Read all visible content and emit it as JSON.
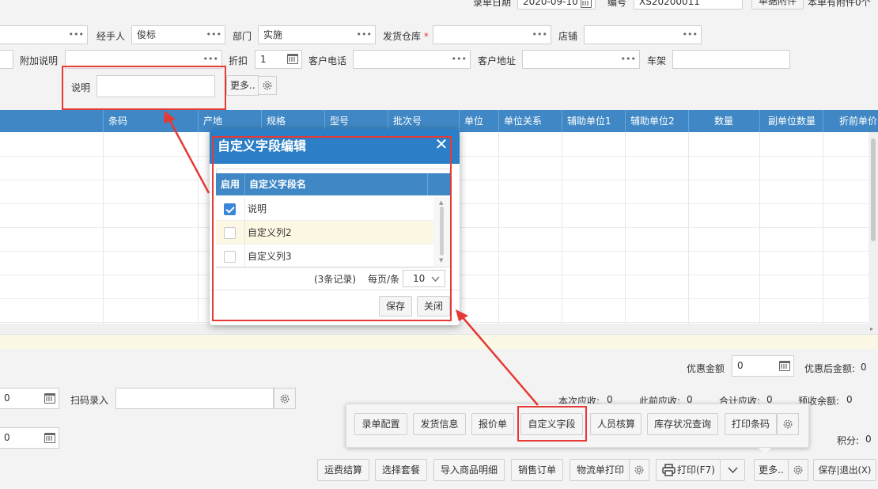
{
  "header_top": {
    "date_label": "录单日期",
    "date_value": "2020-09-10",
    "no_label": "编号",
    "no_value": "XS20200011",
    "attach_btn": "单据附件",
    "attach_info": "本单有附件0个"
  },
  "form": {
    "handler_label": "经手人",
    "handler_value": "俊标",
    "dept_label": "部门",
    "dept_value": "实施",
    "warehouse_label": "发货仓库",
    "warehouse_req": "*",
    "store_label": "店铺",
    "extra_label": "附加说明",
    "discount_label": "折扣",
    "discount_value": "1",
    "phone_label": "客户电话",
    "address_label": "客户地址",
    "frame_label": "车架",
    "note_label": "说明",
    "more_btn": "更多.."
  },
  "grid": {
    "columns": [
      "条码",
      "产地",
      "规格",
      "型号",
      "批次号",
      "单位",
      "单位关系",
      "辅助单位1",
      "辅助单位2",
      "数量",
      "副单位数量",
      "折前单价"
    ]
  },
  "dialog": {
    "title": "自定义字段编辑",
    "col_enabled": "启用",
    "col_name": "自定义字段名",
    "rows": [
      {
        "name": "说明",
        "checked": true
      },
      {
        "name": "自定义列2",
        "checked": false
      },
      {
        "name": "自定义列3",
        "checked": false
      }
    ],
    "records": "(3条记录)",
    "per_page_label": "每页/条",
    "per_page_value": "10",
    "save_btn": "保存",
    "close_btn": "关闭"
  },
  "bottom": {
    "discount_amount_label": "优惠金额",
    "discount_amount_value": "0",
    "after_discount_label": "优惠后金额:",
    "after_discount_value": "0",
    "left_value1": "0",
    "scan_label": "扫码录入",
    "left_value2": "0",
    "this_receivable": "本次应收:",
    "this_receivable_value": "0",
    "prev_receivable": "此前应收:",
    "prev_receivable_value": "0",
    "total_receivable": "合计应收:",
    "total_receivable_value": "0",
    "prepaid": "预收余额:",
    "prepaid_value": "0",
    "points_label": "积分:",
    "points_value": "0"
  },
  "popup_toolbar": [
    "录单配置",
    "发货信息",
    "报价单",
    "自定义字段",
    "人员核算",
    "库存状况查询",
    "打印条码"
  ],
  "bottom_toolbar": {
    "freight": "运费结算",
    "package": "选择套餐",
    "import": "导入商品明细",
    "sales_order": "销售订单",
    "logistics_print": "物流单打印",
    "print": "打印(F7)",
    "more": "更多..",
    "save_exit": "保存|退出(X)"
  },
  "colors": {
    "header_blue": "#3f88c5",
    "dialog_blue": "#2c7ec6",
    "annotation_red": "#e53935"
  }
}
